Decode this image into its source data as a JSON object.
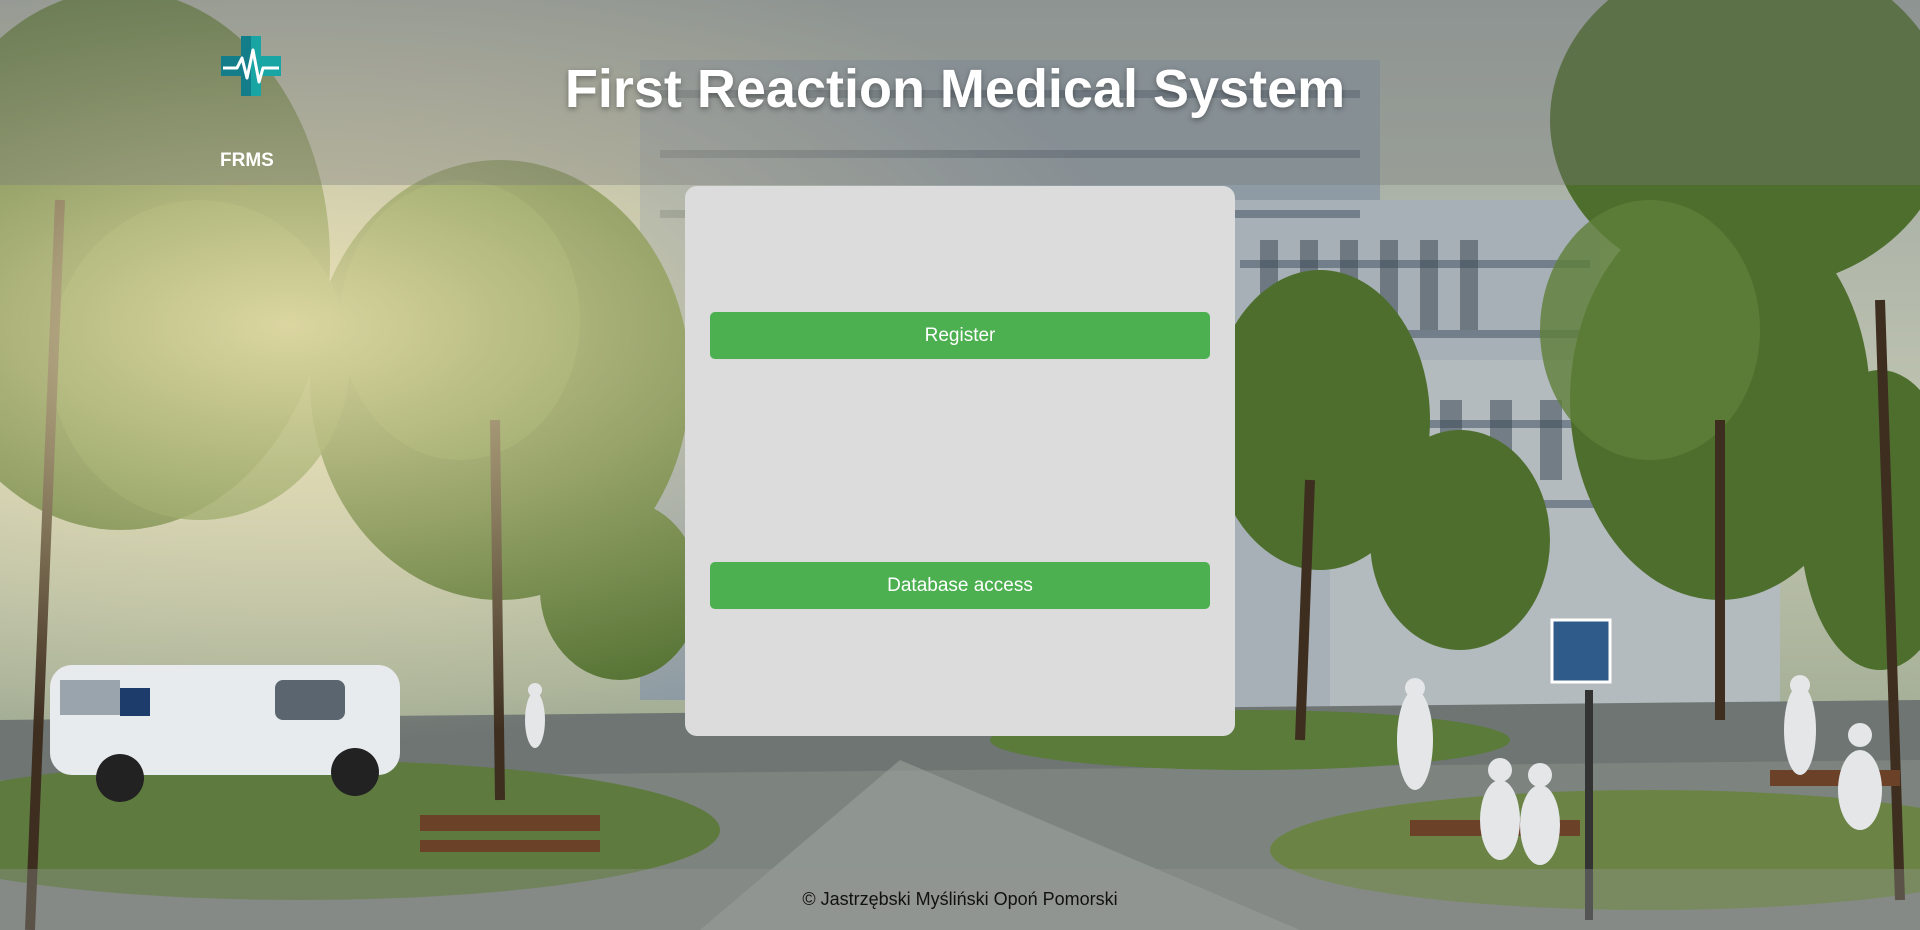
{
  "header": {
    "title": "First Reaction Medical System",
    "brand_label": "FRMS",
    "logo_icon": "medical-cross-heartbeat-icon"
  },
  "card": {
    "register_label": "Register",
    "database_access_label": "Database access"
  },
  "footer": {
    "copyright": "© Jastrzębski Myśliński Opoń Pomorski"
  },
  "colors": {
    "button": "#4caf50",
    "card": "#dcdcdc",
    "logo": "#1aa5a5"
  }
}
